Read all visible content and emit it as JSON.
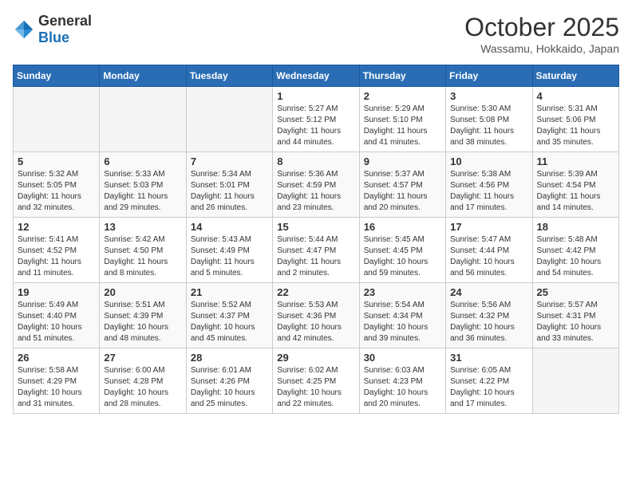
{
  "header": {
    "logo_general": "General",
    "logo_blue": "Blue",
    "month_year": "October 2025",
    "location": "Wassamu, Hokkaido, Japan"
  },
  "days_of_week": [
    "Sunday",
    "Monday",
    "Tuesday",
    "Wednesday",
    "Thursday",
    "Friday",
    "Saturday"
  ],
  "weeks": [
    [
      {
        "day": "",
        "info": ""
      },
      {
        "day": "",
        "info": ""
      },
      {
        "day": "",
        "info": ""
      },
      {
        "day": "1",
        "info": "Sunrise: 5:27 AM\nSunset: 5:12 PM\nDaylight: 11 hours and 44 minutes."
      },
      {
        "day": "2",
        "info": "Sunrise: 5:29 AM\nSunset: 5:10 PM\nDaylight: 11 hours and 41 minutes."
      },
      {
        "day": "3",
        "info": "Sunrise: 5:30 AM\nSunset: 5:08 PM\nDaylight: 11 hours and 38 minutes."
      },
      {
        "day": "4",
        "info": "Sunrise: 5:31 AM\nSunset: 5:06 PM\nDaylight: 11 hours and 35 minutes."
      }
    ],
    [
      {
        "day": "5",
        "info": "Sunrise: 5:32 AM\nSunset: 5:05 PM\nDaylight: 11 hours and 32 minutes."
      },
      {
        "day": "6",
        "info": "Sunrise: 5:33 AM\nSunset: 5:03 PM\nDaylight: 11 hours and 29 minutes."
      },
      {
        "day": "7",
        "info": "Sunrise: 5:34 AM\nSunset: 5:01 PM\nDaylight: 11 hours and 26 minutes."
      },
      {
        "day": "8",
        "info": "Sunrise: 5:36 AM\nSunset: 4:59 PM\nDaylight: 11 hours and 23 minutes."
      },
      {
        "day": "9",
        "info": "Sunrise: 5:37 AM\nSunset: 4:57 PM\nDaylight: 11 hours and 20 minutes."
      },
      {
        "day": "10",
        "info": "Sunrise: 5:38 AM\nSunset: 4:56 PM\nDaylight: 11 hours and 17 minutes."
      },
      {
        "day": "11",
        "info": "Sunrise: 5:39 AM\nSunset: 4:54 PM\nDaylight: 11 hours and 14 minutes."
      }
    ],
    [
      {
        "day": "12",
        "info": "Sunrise: 5:41 AM\nSunset: 4:52 PM\nDaylight: 11 hours and 11 minutes."
      },
      {
        "day": "13",
        "info": "Sunrise: 5:42 AM\nSunset: 4:50 PM\nDaylight: 11 hours and 8 minutes."
      },
      {
        "day": "14",
        "info": "Sunrise: 5:43 AM\nSunset: 4:49 PM\nDaylight: 11 hours and 5 minutes."
      },
      {
        "day": "15",
        "info": "Sunrise: 5:44 AM\nSunset: 4:47 PM\nDaylight: 11 hours and 2 minutes."
      },
      {
        "day": "16",
        "info": "Sunrise: 5:45 AM\nSunset: 4:45 PM\nDaylight: 10 hours and 59 minutes."
      },
      {
        "day": "17",
        "info": "Sunrise: 5:47 AM\nSunset: 4:44 PM\nDaylight: 10 hours and 56 minutes."
      },
      {
        "day": "18",
        "info": "Sunrise: 5:48 AM\nSunset: 4:42 PM\nDaylight: 10 hours and 54 minutes."
      }
    ],
    [
      {
        "day": "19",
        "info": "Sunrise: 5:49 AM\nSunset: 4:40 PM\nDaylight: 10 hours and 51 minutes."
      },
      {
        "day": "20",
        "info": "Sunrise: 5:51 AM\nSunset: 4:39 PM\nDaylight: 10 hours and 48 minutes."
      },
      {
        "day": "21",
        "info": "Sunrise: 5:52 AM\nSunset: 4:37 PM\nDaylight: 10 hours and 45 minutes."
      },
      {
        "day": "22",
        "info": "Sunrise: 5:53 AM\nSunset: 4:36 PM\nDaylight: 10 hours and 42 minutes."
      },
      {
        "day": "23",
        "info": "Sunrise: 5:54 AM\nSunset: 4:34 PM\nDaylight: 10 hours and 39 minutes."
      },
      {
        "day": "24",
        "info": "Sunrise: 5:56 AM\nSunset: 4:32 PM\nDaylight: 10 hours and 36 minutes."
      },
      {
        "day": "25",
        "info": "Sunrise: 5:57 AM\nSunset: 4:31 PM\nDaylight: 10 hours and 33 minutes."
      }
    ],
    [
      {
        "day": "26",
        "info": "Sunrise: 5:58 AM\nSunset: 4:29 PM\nDaylight: 10 hours and 31 minutes."
      },
      {
        "day": "27",
        "info": "Sunrise: 6:00 AM\nSunset: 4:28 PM\nDaylight: 10 hours and 28 minutes."
      },
      {
        "day": "28",
        "info": "Sunrise: 6:01 AM\nSunset: 4:26 PM\nDaylight: 10 hours and 25 minutes."
      },
      {
        "day": "29",
        "info": "Sunrise: 6:02 AM\nSunset: 4:25 PM\nDaylight: 10 hours and 22 minutes."
      },
      {
        "day": "30",
        "info": "Sunrise: 6:03 AM\nSunset: 4:23 PM\nDaylight: 10 hours and 20 minutes."
      },
      {
        "day": "31",
        "info": "Sunrise: 6:05 AM\nSunset: 4:22 PM\nDaylight: 10 hours and 17 minutes."
      },
      {
        "day": "",
        "info": ""
      }
    ]
  ]
}
